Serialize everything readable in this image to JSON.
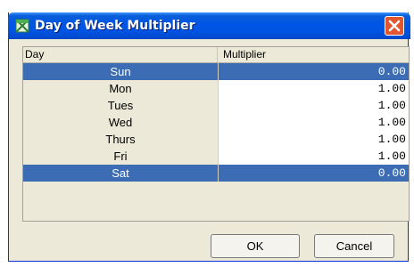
{
  "window": {
    "title": "Day of Week Multiplier",
    "icon": "calendar-app-icon",
    "close_icon": "close-icon"
  },
  "table": {
    "columns": [
      "Day",
      "Multiplier"
    ],
    "rows": [
      {
        "day": "Sun",
        "multiplier": "0.00",
        "selected": true
      },
      {
        "day": "Mon",
        "multiplier": "1.00",
        "selected": false
      },
      {
        "day": "Tues",
        "multiplier": "1.00",
        "selected": false
      },
      {
        "day": "Wed",
        "multiplier": "1.00",
        "selected": false
      },
      {
        "day": "Thurs",
        "multiplier": "1.00",
        "selected": false
      },
      {
        "day": "Fri",
        "multiplier": "1.00",
        "selected": false
      },
      {
        "day": "Sat",
        "multiplier": "0.00",
        "selected": true
      }
    ]
  },
  "buttons": {
    "ok_label": "OK",
    "cancel_label": "Cancel"
  },
  "colors": {
    "titlebar": "#0054e3",
    "selection": "#3b6cb4",
    "close": "#e2572f"
  }
}
